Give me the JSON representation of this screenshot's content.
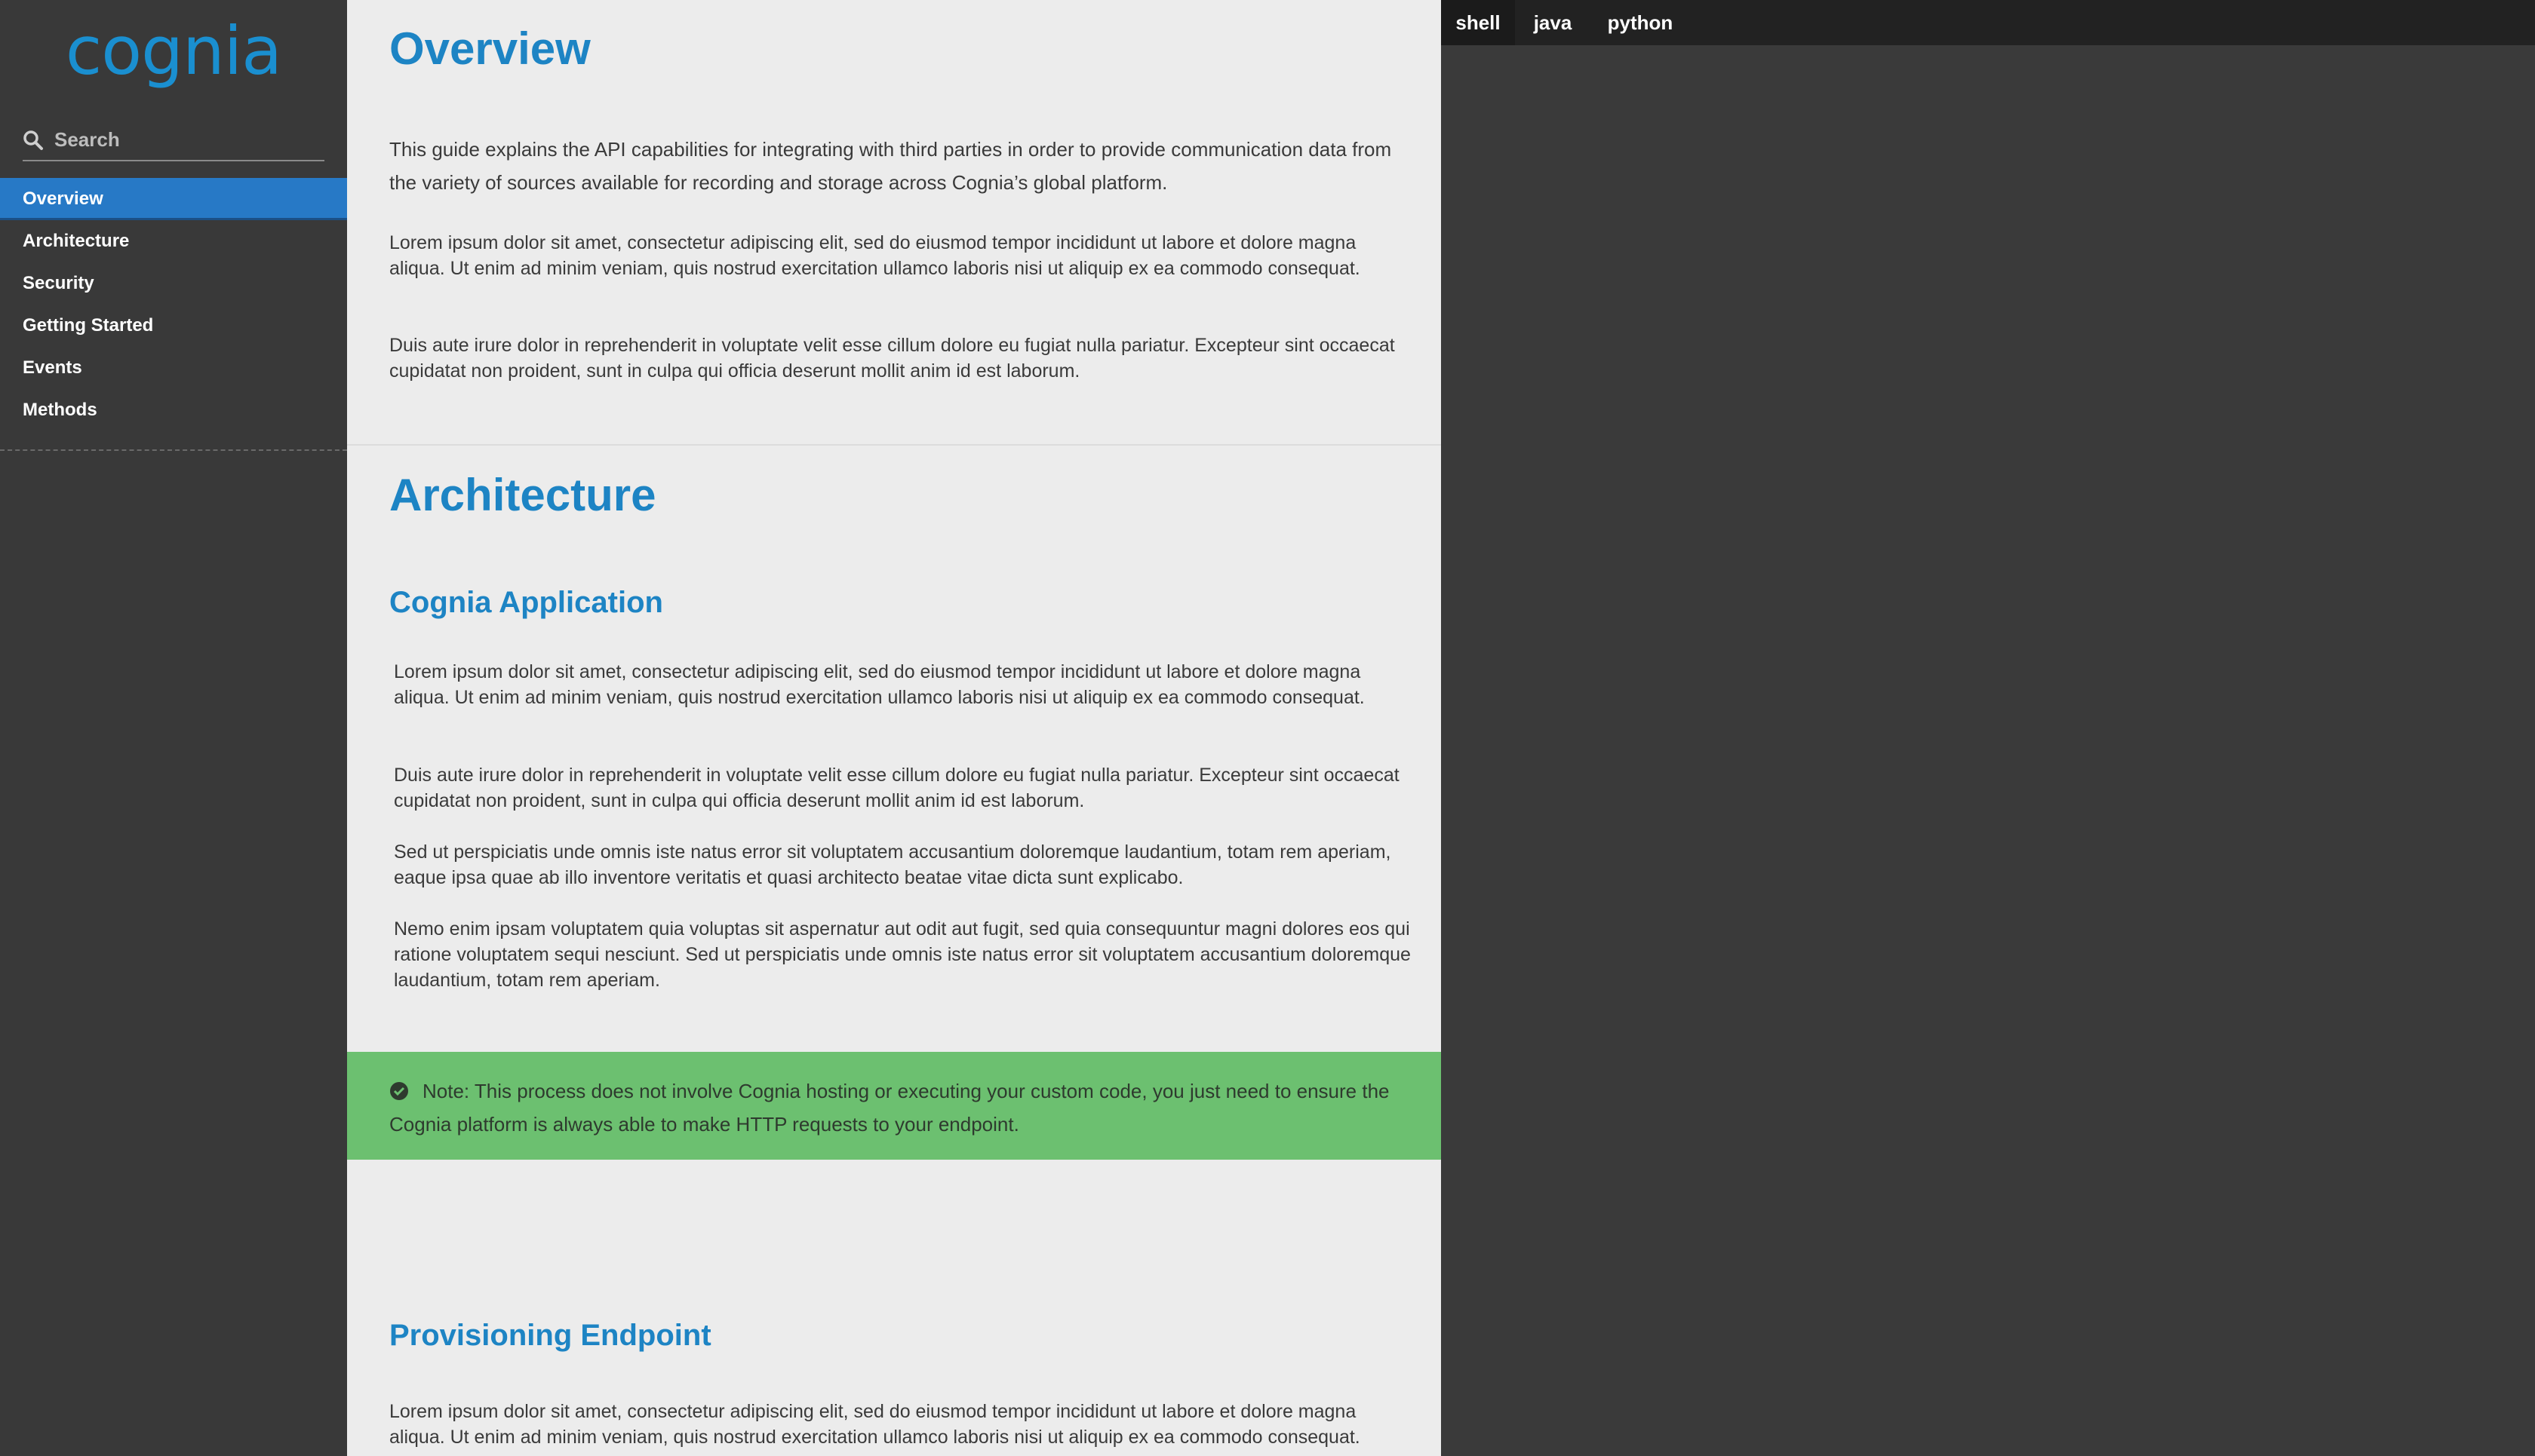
{
  "sidebar": {
    "logo": "cognia",
    "search_placeholder": "Search",
    "items": [
      {
        "label": "Overview"
      },
      {
        "label": "Architecture"
      },
      {
        "label": "Security"
      },
      {
        "label": "Getting Started"
      },
      {
        "label": "Events"
      },
      {
        "label": "Methods"
      }
    ],
    "active_index": 0
  },
  "main": {
    "overview": {
      "title": "Overview",
      "lead": "This guide explains the API capabilities for integrating with third parties in order to provide communication data from the variety of sources available for recording and storage across Cognia’s global platform.",
      "p1": "Lorem ipsum dolor sit amet, consectetur adipiscing elit, sed do eiusmod tempor incididunt ut labore et dolore magna aliqua. Ut enim ad minim veniam, quis nostrud exercitation ullamco laboris nisi ut aliquip ex ea commodo consequat.",
      "p2": "Duis aute irure dolor in reprehenderit in voluptate velit esse cillum dolore eu fugiat nulla pariatur. Excepteur sint oc­caecat cupidatat non proident, sunt in culpa qui officia deserunt mollit anim id est laborum."
    },
    "architecture": {
      "title": "Architecture",
      "subtitle": "Cognia Application",
      "p1": "Lorem ipsum dolor sit amet, consectetur adipiscing elit, sed do eiusmod tempor incididunt ut labore et dolore magna aliqua. Ut enim ad minim veniam, quis nostrud exercitation ullamco laboris nisi ut aliquip ex ea commodo consequat.",
      "p2": "Duis aute irure dolor in reprehenderit in voluptate velit esse cillum dolore eu fugiat nulla pariatur. Excepteur sint oc­caecat cupidatat non proident, sunt in culpa qui officia deserunt mollit anim id est laborum.",
      "p3": "Sed ut perspiciatis unde omnis iste natus error sit voluptatem accusantium doloremque laudantium, totam rem aperiam, eaque ipsa quae ab illo inventore veritatis et quasi architecto beatae vitae dicta sunt explicabo.",
      "p4": "Nemo enim ipsam voluptatem quia voluptas sit aspernatur aut odit aut fugit, sed quia consequuntur magni dolores eos qui ratione voluptatem sequi nesciunt. Sed ut perspiciatis unde omnis iste natus error sit voluptatem accusan­tium doloremque laudantium, totam rem aperiam."
    },
    "note": "Note: This process does not involve Cognia hosting or executing your custom code, you just need to ensure the Cognia platform is always able to make HTTP requests to your endpoint.",
    "provisioning": {
      "title": "Provisioning Endpoint",
      "p1": "Lorem ipsum dolor sit amet, consectetur adipiscing elit, sed do eiusmod tempor incididunt ut labore et dolore magna aliqua. Ut enim ad minim veniam, quis nostrud exercitation ullamco laboris nisi ut aliquip ex ea commodo consequat."
    }
  },
  "code_tabs": [
    {
      "label": "shell"
    },
    {
      "label": "java"
    },
    {
      "label": "python"
    }
  ],
  "colors": {
    "sidebar_bg": "#393939",
    "accent": "#2779c6",
    "heading": "#1d84c4",
    "note_bg": "#6cc070",
    "code_bg": "#3a3a3a",
    "tab_bar_bg": "#222222"
  },
  "icons": {
    "search": "search-icon",
    "note": "check-circle-icon"
  }
}
